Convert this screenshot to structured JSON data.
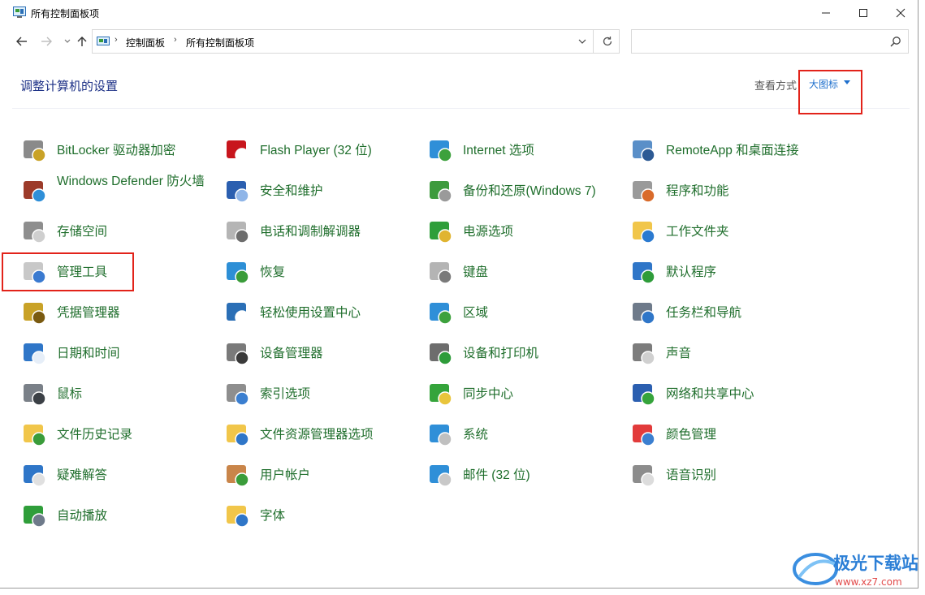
{
  "window": {
    "title": "所有控制面板项"
  },
  "address": {
    "crumbs": [
      "控制面板",
      "所有控制面板项"
    ],
    "search_placeholder": ""
  },
  "header": {
    "title": "调整计算机的设置",
    "view_by_label": "查看方式",
    "view_by_value": "大图标"
  },
  "items": [
    {
      "label": "BitLocker 驱动器加密",
      "icon": "bitlocker-icon"
    },
    {
      "label": "Flash Player (32 位)",
      "icon": "flash-icon"
    },
    {
      "label": "Internet 选项",
      "icon": "internet-icon"
    },
    {
      "label": "RemoteApp 和桌面连接",
      "icon": "remoteapp-icon"
    },
    {
      "label": "Windows Defender 防火墙",
      "icon": "firewall-icon"
    },
    {
      "label": "安全和维护",
      "icon": "flag-icon"
    },
    {
      "label": "备份和还原(Windows 7)",
      "icon": "backup-icon"
    },
    {
      "label": "程序和功能",
      "icon": "programs-icon"
    },
    {
      "label": "存储空间",
      "icon": "storage-icon"
    },
    {
      "label": "电话和调制解调器",
      "icon": "phone-icon"
    },
    {
      "label": "电源选项",
      "icon": "power-icon"
    },
    {
      "label": "工作文件夹",
      "icon": "work-folder-icon"
    },
    {
      "label": "管理工具",
      "icon": "admin-tools-icon"
    },
    {
      "label": "恢复",
      "icon": "recovery-icon"
    },
    {
      "label": "键盘",
      "icon": "keyboard-icon"
    },
    {
      "label": "默认程序",
      "icon": "default-programs-icon"
    },
    {
      "label": "凭据管理器",
      "icon": "credential-icon"
    },
    {
      "label": "轻松使用设置中心",
      "icon": "ease-of-access-icon"
    },
    {
      "label": "区域",
      "icon": "region-icon"
    },
    {
      "label": "任务栏和导航",
      "icon": "taskbar-icon"
    },
    {
      "label": "日期和时间",
      "icon": "calendar-icon"
    },
    {
      "label": "设备管理器",
      "icon": "device-manager-icon"
    },
    {
      "label": "设备和打印机",
      "icon": "printer-icon"
    },
    {
      "label": "声音",
      "icon": "speaker-icon"
    },
    {
      "label": "鼠标",
      "icon": "mouse-icon"
    },
    {
      "label": "索引选项",
      "icon": "indexing-icon"
    },
    {
      "label": "同步中心",
      "icon": "sync-icon"
    },
    {
      "label": "网络和共享中心",
      "icon": "network-icon"
    },
    {
      "label": "文件历史记录",
      "icon": "file-history-icon"
    },
    {
      "label": "文件资源管理器选项",
      "icon": "explorer-options-icon"
    },
    {
      "label": "系统",
      "icon": "system-icon"
    },
    {
      "label": "颜色管理",
      "icon": "color-management-icon"
    },
    {
      "label": "疑难解答",
      "icon": "troubleshooting-icon"
    },
    {
      "label": "用户帐户",
      "icon": "users-icon"
    },
    {
      "label": "邮件 (32 位)",
      "icon": "mail-icon"
    },
    {
      "label": "语音识别",
      "icon": "microphone-icon"
    },
    {
      "label": "自动播放",
      "icon": "autoplay-icon"
    },
    {
      "label": "字体",
      "icon": "fonts-icon"
    }
  ],
  "colors": {
    "link_green": "#1f6e2c",
    "heading_blue": "#1e3287",
    "highlight_red": "#e2231a"
  },
  "watermark": {
    "brand": "极光下载站",
    "url": "www.xz7.com"
  }
}
